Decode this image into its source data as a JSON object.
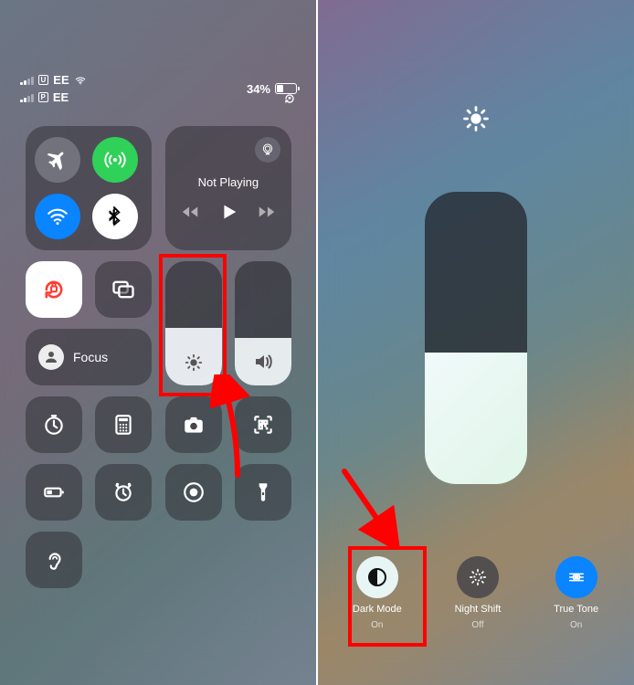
{
  "status": {
    "carrier1": "EE",
    "sim1_tag": "U",
    "carrier2": "EE",
    "sim2_tag": "P",
    "battery_percent": "34%"
  },
  "media": {
    "now_playing": "Not Playing"
  },
  "focus": {
    "label": "Focus"
  },
  "sliders": {
    "brightness_pct": 46,
    "volume_pct": 38
  },
  "right_panel": {
    "brightness_pct": 45,
    "options": [
      {
        "label": "Dark Mode",
        "state": "On"
      },
      {
        "label": "Night Shift",
        "state": "Off"
      },
      {
        "label": "True Tone",
        "state": "On"
      }
    ]
  },
  "colors": {
    "accent_blue": "#0a84ff",
    "accent_green": "#30d158",
    "accent_red_annotation": "#ff0000",
    "rotation_lock_red": "#ff3b30"
  }
}
